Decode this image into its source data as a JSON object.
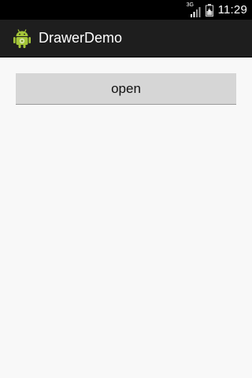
{
  "status_bar": {
    "network_label": "3G",
    "signal_icon": "signal-bars-icon",
    "battery_icon": "battery-icon",
    "time": "11:29"
  },
  "action_bar": {
    "app_icon": "android-robot-icon",
    "title": "DrawerDemo"
  },
  "main": {
    "open_button_label": "open"
  },
  "colors": {
    "status_bar_bg": "#000000",
    "action_bar_bg": "#1e1e1e",
    "content_bg": "#f8f8f8",
    "button_bg": "#d6d6d6",
    "android_green": "#a4c639"
  }
}
